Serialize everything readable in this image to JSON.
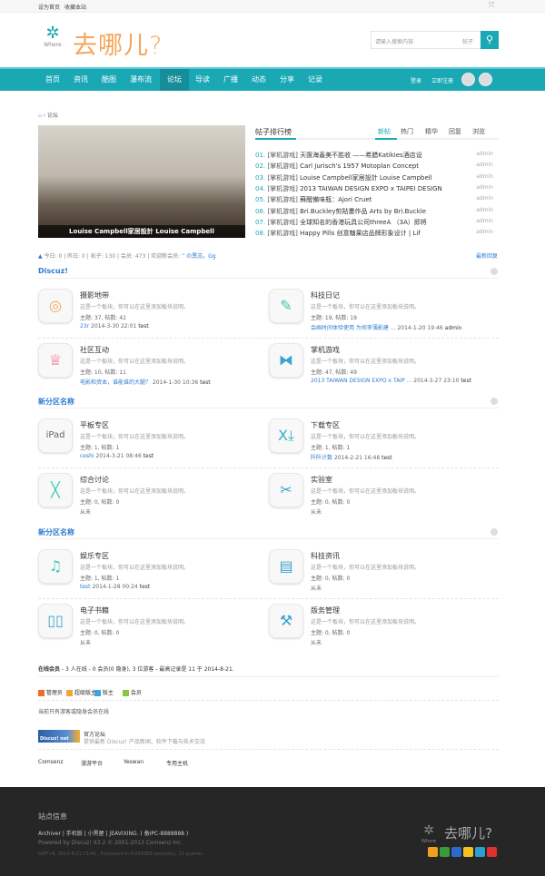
{
  "topbar": {
    "links": [
      "设为首页",
      "收藏本站"
    ],
    "expand_icon": "expand-icon"
  },
  "header": {
    "logo_sub": "Where",
    "logo_text": "去哪儿?",
    "search_placeholder": "请输入搜索内容",
    "search_scope": "帖子",
    "search_icon": "search-icon"
  },
  "nav": {
    "items": [
      "首页",
      "资讯",
      "酷图",
      "瀑布流",
      "论坛",
      "导读",
      "广播",
      "动态",
      "分享",
      "记录"
    ],
    "active": "论坛",
    "login": "登录",
    "register": "立即注册",
    "colors": {
      "nav": "#1aa8b5",
      "logo": "#f5a55a"
    }
  },
  "breadcrumb": {
    "current": "论坛"
  },
  "slider": {
    "caption": "Louise Campbell家居設計 Louise Campbell"
  },
  "ranking": {
    "title": "帖子排行榜",
    "tabs": [
      "新帖",
      "热门",
      "精华",
      "回复",
      "浏览"
    ],
    "active_tab": "新帖",
    "items": [
      {
        "n": "01.",
        "cat": "[掌机游戏]",
        "title": "天匯海蓋美不胜收 ——希腊Katikies酒店设",
        "author": "admin"
      },
      {
        "n": "02.",
        "cat": "[掌机游戏]",
        "title": "Carl Jurisch's 1957 Motoplan Concept",
        "author": "admin"
      },
      {
        "n": "03.",
        "cat": "[掌机游戏]",
        "title": "Louise Campbell家居設計 Louise Campbell",
        "author": "admin"
      },
      {
        "n": "04.",
        "cat": "[掌机游戏]",
        "title": "2013 TAIWAN DESIGN EXPO x TAIPEI DESIGN",
        "author": "admin"
      },
      {
        "n": "05.",
        "cat": "[掌机游戏]",
        "title": "蘇醒備味瓶：Ajori Cruet",
        "author": "admin"
      },
      {
        "n": "06.",
        "cat": "[掌机游戏]",
        "title": "Bri.Buckley剪貼畫作品 Arts by Bri.Buckle",
        "author": "admin"
      },
      {
        "n": "07.",
        "cat": "[掌机游戏]",
        "title": "全球知名的香港玩具公司threeA （3A）即将",
        "author": "admin"
      },
      {
        "n": "08.",
        "cat": "[掌机游戏]",
        "title": "Happy Pills 创意糖果店品牌形象设计 | Lif",
        "author": "admin"
      }
    ]
  },
  "stats": {
    "text": "今日: 0 | 昨日: 0 | 帖子: 130 | 会员: 473 | 欢迎新会员: ",
    "new_member": "” の異志。Gg",
    "latest": "最新回复"
  },
  "sections": [
    {
      "title": "Discuz!",
      "forums": [
        {
          "icon": "camera-icon",
          "name": "摄影地带",
          "desc": "这是一个板块，你可以在这里添加板块说明。",
          "stats": "主题: 37, 帖数: 42",
          "last_link": "23r",
          "last_time": "2014-3-30 22:01",
          "last_user": "test"
        },
        {
          "icon": "pencil-icon",
          "name": "科技日记",
          "desc": "这是一个板块，你可以在这里添加板块说明。",
          "stats": "主题: 19, 帖数: 19",
          "last_link": "会画时间体验使用 为何孪薄影建 ...",
          "last_time": "2014-1-20 19:46",
          "last_user": "admin"
        },
        {
          "icon": "medal-icon",
          "name": "社区互动",
          "desc": "这是一个板块，你可以在这里添加板块说明。",
          "stats": "主题: 10, 帖数: 11",
          "last_link": "电影和资本，谁能谁的大腿？",
          "last_time": "2014-1-30 10:36",
          "last_user": "test"
        },
        {
          "icon": "gamepad-icon",
          "name": "掌机游戏",
          "desc": "这是一个板块，你可以在这里添加板块说明。",
          "stats": "主题: 47, 帖数: 49",
          "last_link": "2013 TAIWAN DESIGN EXPO x TAIP ...",
          "last_time": "2014-3-27 23:10",
          "last_user": "test"
        }
      ]
    },
    {
      "title": "新分区名称",
      "forums": [
        {
          "icon": "ipad-icon",
          "name": "平板专区",
          "desc": "这是一个板块，你可以在这里添加板块说明。",
          "stats": "主题: 1, 帖数: 1",
          "last_link": "ceshi",
          "last_time": "2014-3-21 08:46",
          "last_user": "test"
        },
        {
          "icon": "download-icon",
          "name": "下载专区",
          "desc": "这是一个板块，你可以在这里添加板块说明。",
          "stats": "主题: 1, 帖数: 1",
          "last_link": "阡阡计数",
          "last_time": "2014-2-21 16:48",
          "last_user": "test"
        },
        {
          "icon": "x-icon",
          "name": "综合讨论",
          "desc": "这是一个板块，你可以在这里添加板块说明。",
          "stats": "主题: 0, 帖数: 0",
          "never": "从未"
        },
        {
          "icon": "tools-icon",
          "name": "实验室",
          "desc": "这是一个板块，你可以在这里添加板块说明。",
          "stats": "主题: 0, 帖数: 0",
          "never": "从未"
        }
      ]
    },
    {
      "title": "新分区名称",
      "forums": [
        {
          "icon": "music-icon",
          "name": "娱乐专区",
          "desc": "这是一个板块，你可以在这里添加板块说明。",
          "stats": "主题: 1, 帖数: 1",
          "last_link": "test",
          "last_time": "2014-1-28 00:24",
          "last_user": "test"
        },
        {
          "icon": "news-icon",
          "name": "科技资讯",
          "desc": "这是一个板块，你可以在这里添加板块说明。",
          "stats": "主题: 0, 帖数: 0",
          "never": "从未"
        },
        {
          "icon": "book-icon",
          "name": "电子书籍",
          "desc": "这是一个板块，你可以在这里添加板块说明。",
          "stats": "主题: 0, 帖数: 0",
          "never": "从未"
        },
        {
          "icon": "hammer-icon",
          "name": "版务管理",
          "desc": "这是一个板块，你可以在这里添加板块说明。",
          "stats": "主题: 0, 帖数: 0",
          "never": "从未"
        }
      ]
    }
  ],
  "online": {
    "label": "在线会员",
    "text": " - 3 人在线 - 0 会员(0 隐身), 3 位游客 - 最高记录是 11 于 2014-8-21.",
    "legend": [
      {
        "label": "管理员",
        "color": "#f06a2a"
      },
      {
        "label": "超级版主",
        "color": "#f5a33a"
      },
      {
        "label": "版主",
        "color": "#3aa3e0"
      },
      {
        "label": "会员",
        "color": "#8cc63e"
      }
    ],
    "note": "当前只有游客或隐身会员在线"
  },
  "official": {
    "badge": "Discuz! net",
    "title": "官方论坛",
    "desc": "提供最新 Discuz! 产品新闻、软件下载与技术交流"
  },
  "friend_links": [
    "Comsenz",
    "漫游平台",
    "Yeswan",
    "专用主机"
  ],
  "footer": {
    "title": "站点信息",
    "links": "Archiver | 手机版 | 小黑屋 | JEAVIXING. ( 备IPC-8888888 )",
    "powered": "Powered by Discuz! X3.2 © 2001-2013 Comsenz Inc.",
    "gmt": "GMT+8, 2014-8-21 13:45 , Processed in 0.093083 second(s), 11 queries .",
    "logo_text": "去哪儿?",
    "logo_sub": "Where",
    "social": [
      "rss-icon",
      "douban-icon",
      "renren-icon",
      "qzone-icon",
      "tencent-icon",
      "weibo-icon"
    ]
  }
}
